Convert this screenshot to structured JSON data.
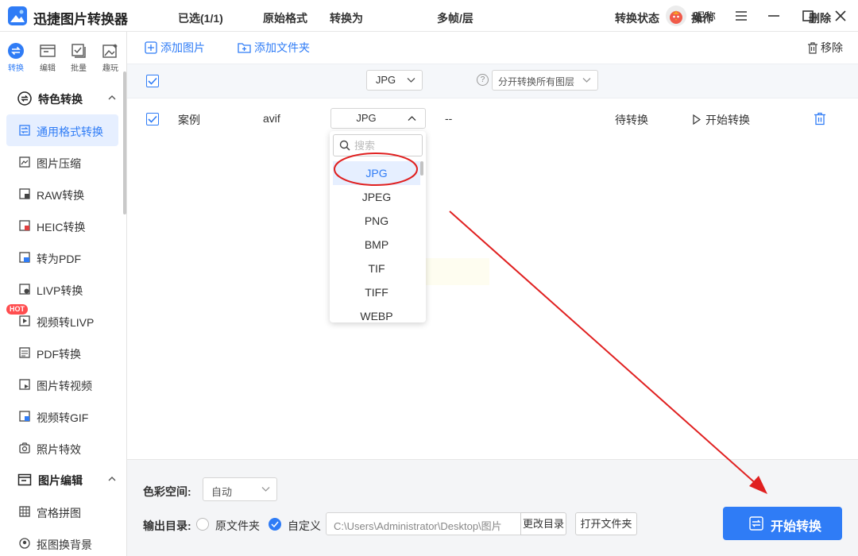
{
  "app": {
    "title": "迅捷图片转换器",
    "nickname": "昵称"
  },
  "rail": [
    {
      "label": "转换",
      "icon": "convert-icon"
    },
    {
      "label": "编辑",
      "icon": "edit-icon"
    },
    {
      "label": "批量",
      "icon": "batch-icon"
    },
    {
      "label": "趣玩",
      "icon": "fun-icon"
    }
  ],
  "sidebar": {
    "cat1": "特色转换",
    "items": [
      "通用格式转换",
      "图片压缩",
      "RAW转换",
      "HEIC转换",
      "转为PDF",
      "LIVP转换",
      "视频转LIVP",
      "PDF转换",
      "图片转视频",
      "视频转GIF",
      "照片特效"
    ],
    "hot_badge": "HOT",
    "cat2": "图片编辑",
    "items2": [
      "宫格拼图",
      "抠图换背景"
    ]
  },
  "toolbar": {
    "add_image": "添加图片",
    "add_folder": "添加文件夹",
    "remove": "移除"
  },
  "table": {
    "selected": "已选(1/1)",
    "col_format": "原始格式",
    "col_convert": "转换为",
    "convert_all_value": "JPG",
    "col_multi": "多帧/层",
    "multi_value": "分开转换所有图层",
    "col_status": "转换状态",
    "col_action": "操作",
    "col_delete": "删除",
    "row": {
      "name": "案例",
      "format": "avif",
      "target": "JPG",
      "multi": "--",
      "status": "待转换",
      "action": "开始转换"
    }
  },
  "dropdown": {
    "search_placeholder": "搜索",
    "options": [
      "JPG",
      "JPEG",
      "PNG",
      "BMP",
      "TIF",
      "TIFF",
      "WEBP"
    ],
    "selected": "JPG"
  },
  "bottom": {
    "color_space_label": "色彩空间:",
    "color_space_value": "自动",
    "output_label": "输出目录:",
    "opt_original": "原文件夹",
    "opt_custom": "自定义",
    "path": "C:\\Users\\Administrator\\Desktop\\图片",
    "change_dir": "更改目录",
    "open_folder": "打开文件夹",
    "start": "开始转换"
  },
  "colors": {
    "accent": "#2f7cf6",
    "annotation": "#e02020",
    "hot": "#ff4d4f"
  }
}
